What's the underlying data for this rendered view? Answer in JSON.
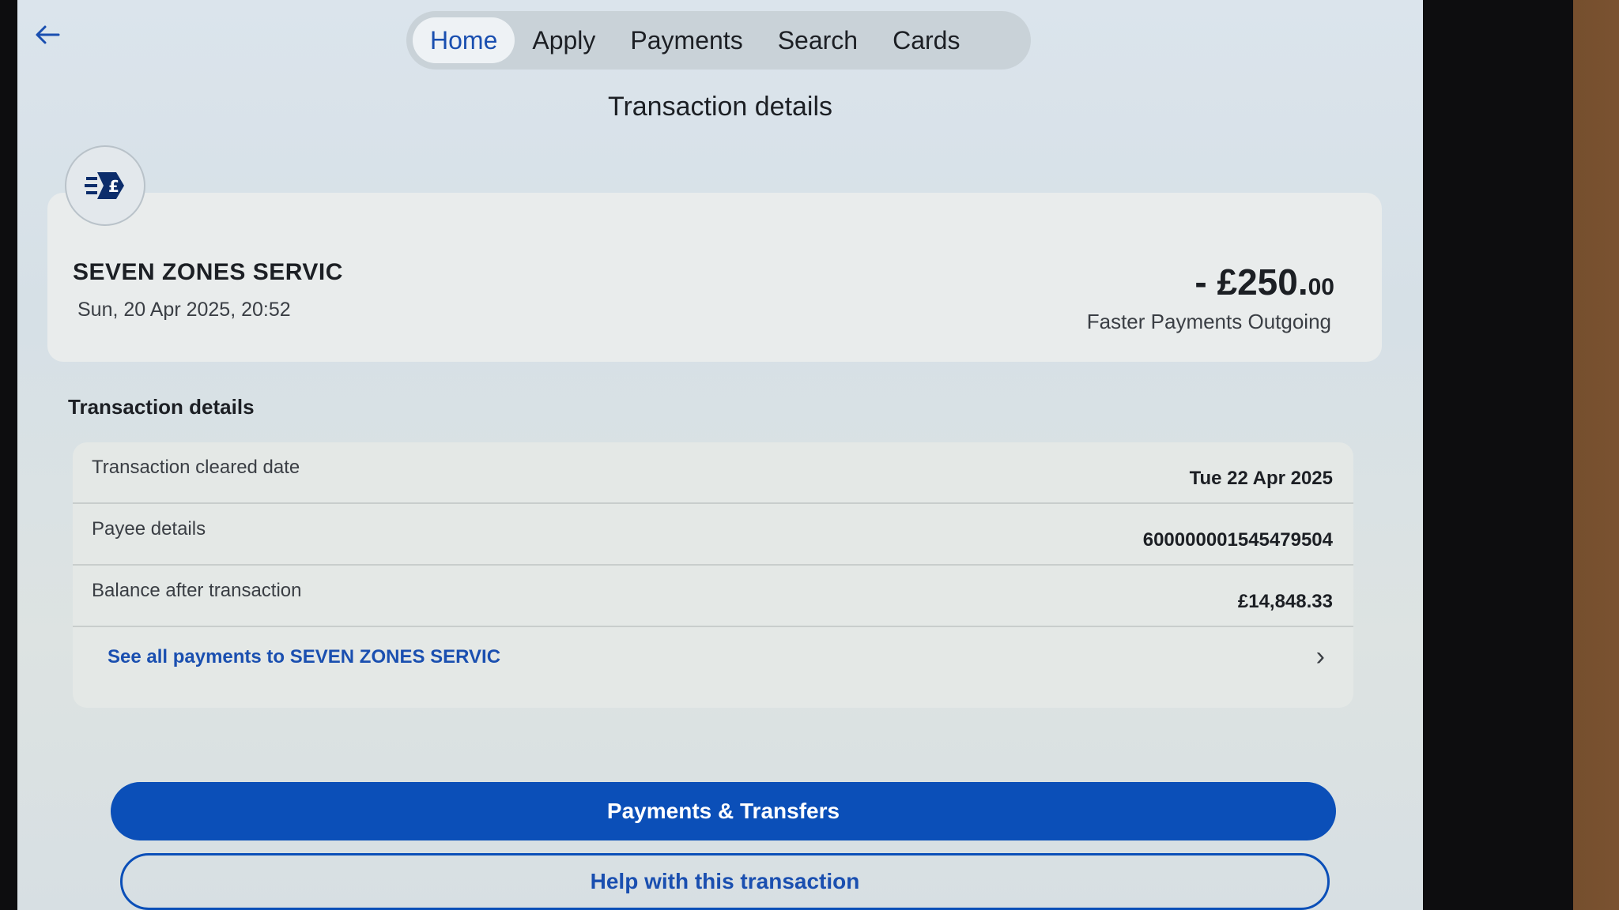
{
  "nav": {
    "back_icon": "arrow-left-icon",
    "tabs": [
      {
        "label": "Home",
        "active": true
      },
      {
        "label": "Apply",
        "active": false
      },
      {
        "label": "Payments",
        "active": false
      },
      {
        "label": "Search",
        "active": false
      },
      {
        "label": "Cards",
        "active": false
      }
    ]
  },
  "page": {
    "title": "Transaction details"
  },
  "summary": {
    "icon": "faster-payment-pound-icon",
    "merchant": "SEVEN ZONES SERVIC",
    "datetime": "Sun, 20 Apr 2025, 20:52",
    "amount_main": "- £250.",
    "amount_pence": "00",
    "payment_type": "Faster Payments Outgoing"
  },
  "details": {
    "heading": "Transaction details",
    "rows": [
      {
        "label": "Transaction cleared date",
        "value": "Tue 22 Apr 2025"
      },
      {
        "label": "Payee details",
        "value": "600000001545479504"
      },
      {
        "label": "Balance after transaction",
        "value": "£14,848.33"
      }
    ],
    "see_all_label": "See all payments to SEVEN ZONES SERVIC"
  },
  "actions": {
    "primary": "Payments & Transfers",
    "secondary": "Help with this transaction"
  },
  "colors": {
    "accent": "#0b4fb8",
    "link": "#1a4fb0"
  }
}
